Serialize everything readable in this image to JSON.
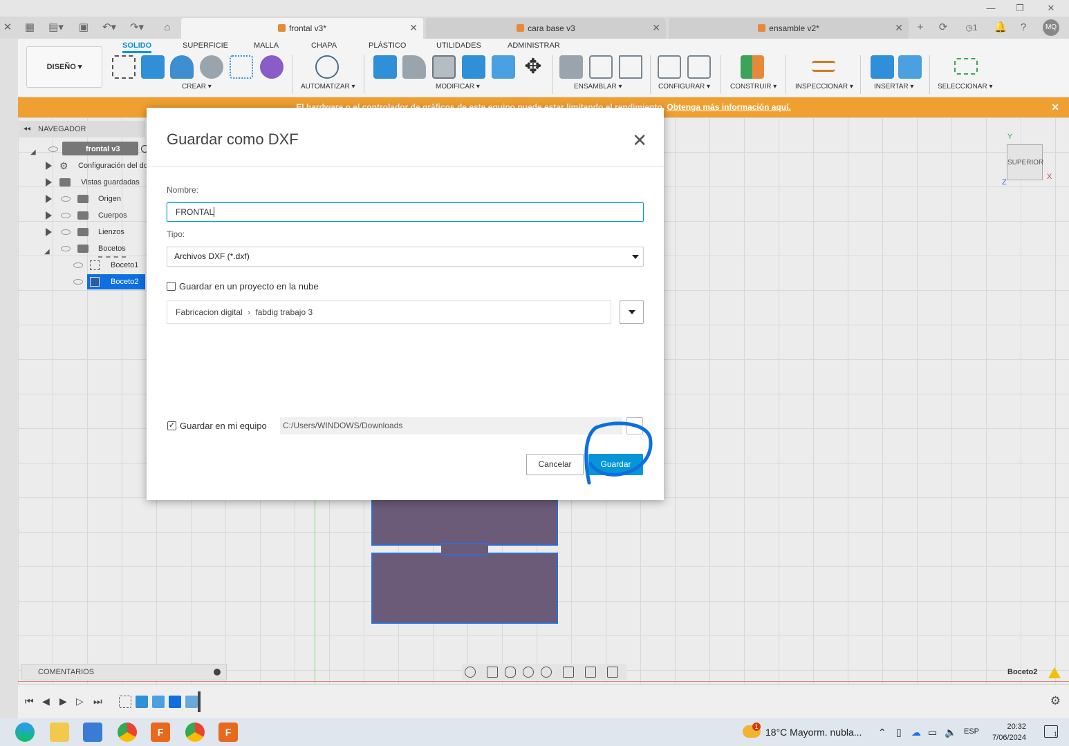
{
  "tabs": [
    {
      "label": "frontal v3*",
      "active": true
    },
    {
      "label": "cara base v3",
      "active": false
    },
    {
      "label": "ensamble v2*",
      "active": false
    }
  ],
  "tabbar": {
    "job_count": "1",
    "user_initials": "MQ"
  },
  "ribbon": {
    "workspace": "DISEÑO ▾",
    "tabs": [
      "SOLIDO",
      "SUPERFICIE",
      "MALLA",
      "CHAPA",
      "PLÁSTICO",
      "UTILIDADES",
      "ADMINISTRAR"
    ],
    "groups": [
      "CREAR ▾",
      "AUTOMATIZAR ▾",
      "MODIFICAR ▾",
      "ENSAMBLAR ▾",
      "CONFIGURAR ▾",
      "CONSTRUIR ▾",
      "INSPECCIONAR ▾",
      "INSERTAR ▾",
      "SELECCIONAR ▾"
    ]
  },
  "warning": {
    "text": "El hardware o el controlador de gráficos de este equipo puede estar limitando el rendimiento.",
    "link": "Obtenga más información aquí."
  },
  "navigator": {
    "title": "NAVEGADOR",
    "root": "frontal v3",
    "items": [
      "Configuración del do",
      "Vistas guardadas",
      "Origen",
      "Cuerpos",
      "Lienzos",
      "Bocetos"
    ],
    "sketches": [
      "Boceto1",
      "Boceto2"
    ]
  },
  "viewcube": {
    "face": "SUPERIOR",
    "axis_y": "Y",
    "axis_x": "X",
    "axis_z": "Z"
  },
  "comments": {
    "label": "COMENTARIOS"
  },
  "status": {
    "active_sketch": "Boceto2"
  },
  "dialog": {
    "title": "Guardar como DXF",
    "name_label": "Nombre:",
    "name_value": "FRONTAL",
    "type_label": "Tipo:",
    "type_value": "Archivos DXF (*.dxf)",
    "cloud_label": "Guardar en un proyecto en la nube",
    "cloud_checked": false,
    "cloud_path_project": "Fabricacion digital",
    "cloud_path_folder": "fabdig trabajo 3",
    "local_label": "Guardar en mi equipo",
    "local_checked": true,
    "local_path": "C:/Users/WINDOWS/Downloads",
    "browse_label": "...",
    "cancel_label": "Cancelar",
    "save_label": "Guardar"
  },
  "taskbar": {
    "weather": "18°C  Mayorm. nubla...",
    "weather_badge": "1",
    "language": "ESP",
    "time": "20:32",
    "date": "7/06/2024",
    "notifications": "1"
  },
  "colors": {
    "accent": "#0696d7",
    "warning": "#f0a030",
    "part": "#6b5a78",
    "highlight": "#0d6fe0"
  }
}
